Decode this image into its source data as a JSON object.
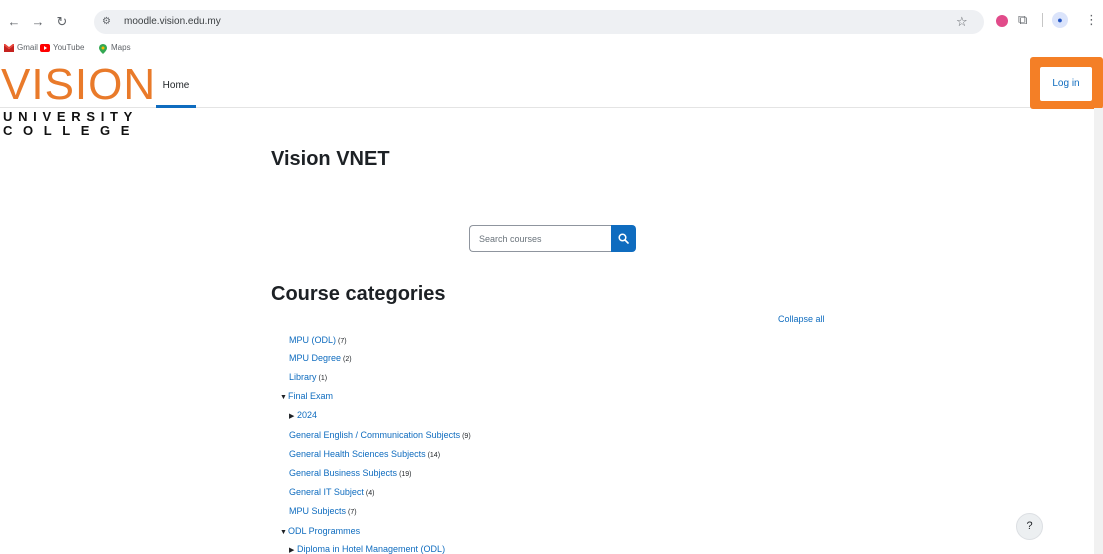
{
  "browser": {
    "url": "moodle.vision.edu.my",
    "bookmarks": [
      {
        "label": "Gmail",
        "icon": "gmail-icon"
      },
      {
        "label": "YouTube",
        "icon": "youtube-icon"
      },
      {
        "label": "Maps",
        "icon": "maps-icon"
      }
    ]
  },
  "header": {
    "logo_main": "VISION",
    "logo_line1": "UNIVERSITY",
    "logo_line2": "COLLEGE",
    "home_tab": "Home",
    "login_label": "Log in",
    "accent_color": "#f47f26",
    "brand_color": "#0f6cbf"
  },
  "main": {
    "site_title": "Vision VNET",
    "search": {
      "placeholder": "Search courses",
      "value": ""
    },
    "categories_heading": "Course categories",
    "collapse_all": "Collapse all",
    "categories": [
      {
        "name": "MPU (ODL)",
        "count": "(7)",
        "arrow": ""
      },
      {
        "name": "MPU Degree",
        "count": "(2)",
        "arrow": ""
      },
      {
        "name": "Library",
        "count": "(1)",
        "arrow": ""
      },
      {
        "name": "Final Exam",
        "count": "",
        "arrow": "▼"
      },
      {
        "name": "2024",
        "count": "",
        "arrow": "▶"
      },
      {
        "name": "General English / Communication Subjects",
        "count": "(9)",
        "arrow": ""
      },
      {
        "name": "General Health Sciences Subjects",
        "count": "(14)",
        "arrow": ""
      },
      {
        "name": "General Business Subjects",
        "count": "(19)",
        "arrow": ""
      },
      {
        "name": "General IT Subject",
        "count": "(4)",
        "arrow": ""
      },
      {
        "name": "MPU Subjects",
        "count": "(7)",
        "arrow": ""
      },
      {
        "name": "ODL Programmes",
        "count": "",
        "arrow": "▼"
      },
      {
        "name": "Diploma in Hotel Management (ODL)",
        "count": "",
        "arrow": "▶"
      }
    ]
  },
  "help": {
    "label": "?"
  }
}
